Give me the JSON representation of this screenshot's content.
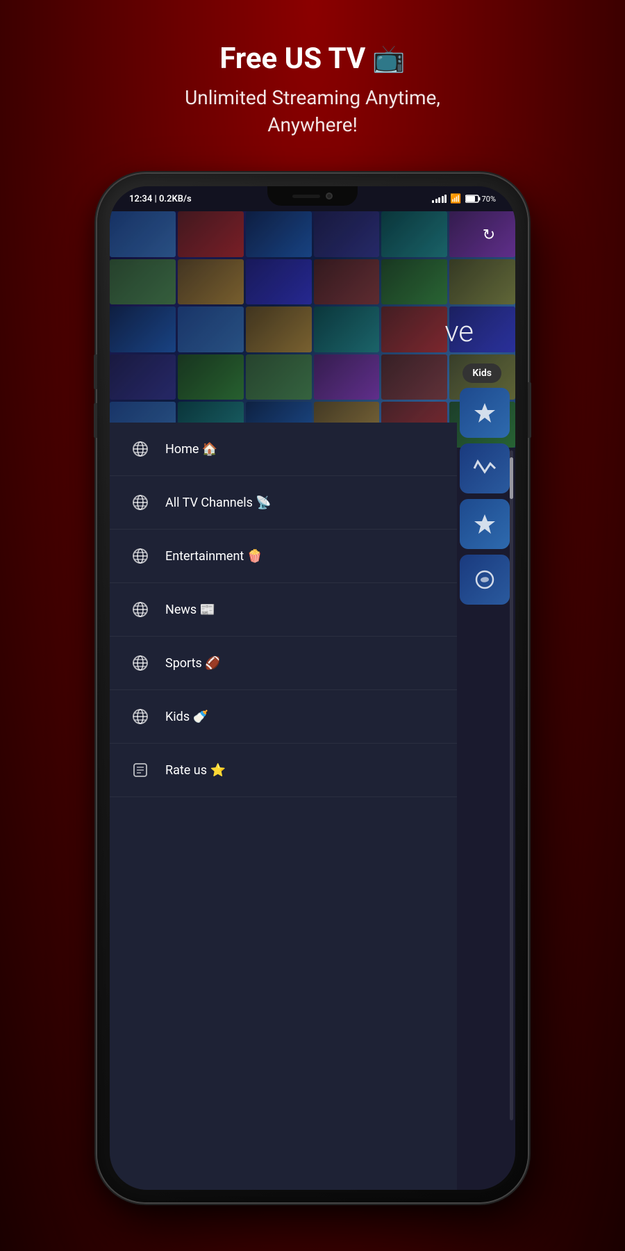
{
  "header": {
    "title": "Free US TV",
    "tv_emoji": "📺",
    "subtitle_line1": "Unlimited Streaming Anytime,",
    "subtitle_line2": "Anywhere!"
  },
  "status_bar": {
    "time": "12:34 | 0.2KB/s",
    "battery": "70%",
    "wifi": "wifi"
  },
  "screen": {
    "live_label": "ve",
    "kids_tab_label": "Kids",
    "refresh_icon": "↻"
  },
  "menu": {
    "items": [
      {
        "id": "home",
        "label": "Home 🏠",
        "icon": "globe"
      },
      {
        "id": "all-tv",
        "label": "All TV Channels 📡",
        "icon": "globe"
      },
      {
        "id": "entertainment",
        "label": "Entertainment 🍿",
        "icon": "globe"
      },
      {
        "id": "news",
        "label": "News 📰",
        "icon": "globe"
      },
      {
        "id": "sports",
        "label": "Sports 🏈",
        "icon": "globe"
      },
      {
        "id": "kids",
        "label": "Kids 🍼",
        "icon": "globe"
      },
      {
        "id": "rate-us",
        "label": "Rate us ⭐",
        "icon": "star-icon"
      }
    ]
  }
}
